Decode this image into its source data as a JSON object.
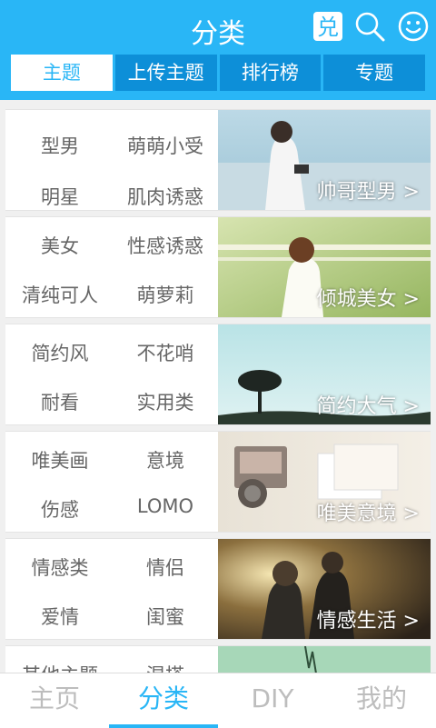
{
  "header": {
    "title": "分类",
    "redeem_icon_glyph": "兑",
    "icons": [
      "redeem-icon",
      "search-icon",
      "smile-icon"
    ]
  },
  "tabs": [
    {
      "label": "主题",
      "active": true
    },
    {
      "label": "上传主题",
      "active": false
    },
    {
      "label": "排行榜",
      "active": false
    },
    {
      "label": "专题",
      "active": false
    }
  ],
  "categories": [
    {
      "tags": [
        "型男",
        "萌萌小受",
        "明星",
        "肌肉诱惑"
      ],
      "label": "帅哥型男 >"
    },
    {
      "tags": [
        "美女",
        "性感诱惑",
        "清纯可人",
        "萌萝莉"
      ],
      "label": "倾城美女 >"
    },
    {
      "tags": [
        "简约风",
        "不花哨",
        "耐看",
        "实用类"
      ],
      "label": "简约大气 >"
    },
    {
      "tags": [
        "唯美画",
        "意境",
        "伤感",
        "LOMO"
      ],
      "label": "唯美意境 >"
    },
    {
      "tags": [
        "情感类",
        "情侣",
        "爱情",
        "闺蜜"
      ],
      "label": "情感生活 >"
    },
    {
      "tags": [
        "其他主题",
        "混搭"
      ]
    }
  ],
  "bottom_nav": [
    {
      "label": "主页",
      "active": false
    },
    {
      "label": "分类",
      "active": true
    },
    {
      "label": "DIY",
      "active": false
    },
    {
      "label": "我的",
      "active": false
    }
  ],
  "colors": {
    "accent": "#29b6f6",
    "tab_bg": "#0d8fd8",
    "tag_text": "#666666"
  }
}
